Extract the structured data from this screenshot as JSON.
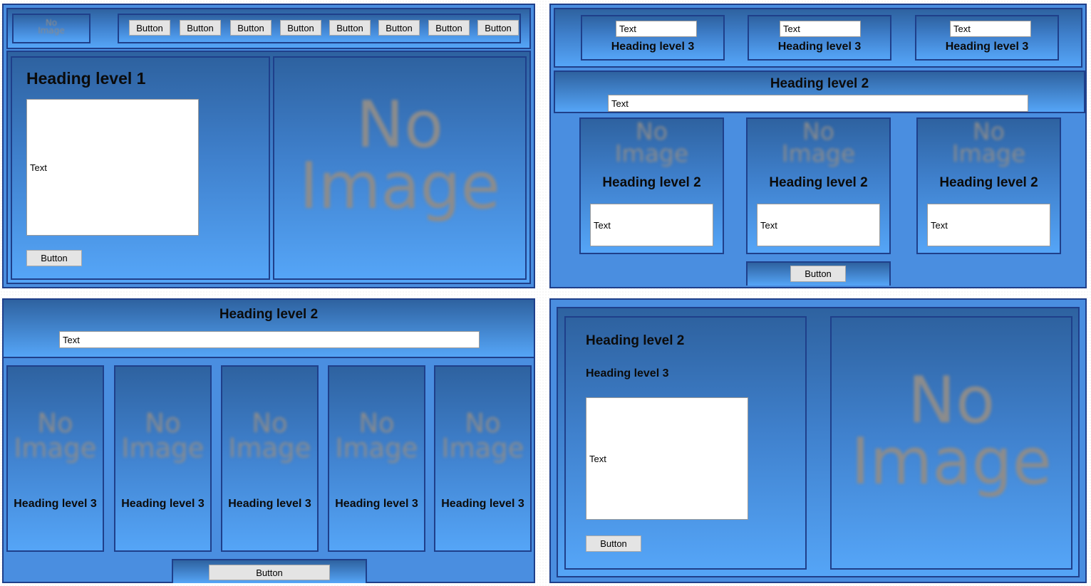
{
  "placeholder_image": {
    "line1": "No",
    "line2": "Image"
  },
  "q1": {
    "nav_buttons": [
      "Button",
      "Button",
      "Button",
      "Button",
      "Button",
      "Button",
      "Button",
      "Button"
    ],
    "heading": "Heading level 1",
    "text": "Text",
    "button": "Button"
  },
  "q2": {
    "top_cards": [
      {
        "text": "Text",
        "heading": "Heading level 3"
      },
      {
        "text": "Text",
        "heading": "Heading level 3"
      },
      {
        "text": "Text",
        "heading": "Heading level 3"
      }
    ],
    "heading": "Heading level 2",
    "text": "Text",
    "cards": [
      {
        "heading": "Heading level 2",
        "text": "Text"
      },
      {
        "heading": "Heading level 2",
        "text": "Text"
      },
      {
        "heading": "Heading level 2",
        "text": "Text"
      }
    ],
    "button": "Button"
  },
  "q3": {
    "heading": "Heading level 2",
    "text": "Text",
    "cards": [
      {
        "heading": "Heading level 3"
      },
      {
        "heading": "Heading level 3"
      },
      {
        "heading": "Heading level 3"
      },
      {
        "heading": "Heading level 3"
      },
      {
        "heading": "Heading level 3"
      }
    ],
    "button": "Button"
  },
  "q4": {
    "heading2": "Heading level 2",
    "heading3": "Heading level 3",
    "text": "Text",
    "button": "Button"
  }
}
